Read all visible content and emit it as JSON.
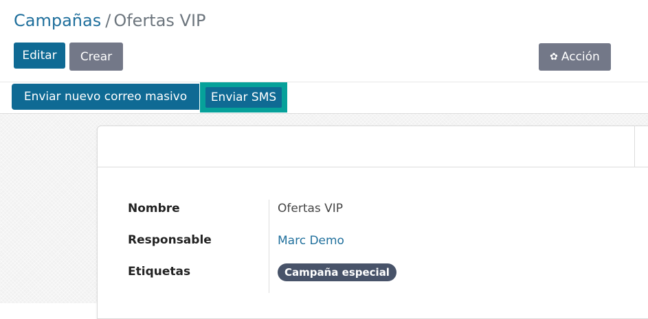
{
  "breadcrumb": {
    "parent": "Campañas",
    "separator": "/",
    "current": "Ofertas VIP"
  },
  "toolbar": {
    "edit_label": "Editar",
    "create_label": "Crear",
    "action_label": "Acción",
    "action_icon": "gear-icon"
  },
  "statusbar": {
    "mass_mail_label": "Enviar nuevo correo masivo",
    "sms_label": "Enviar SMS"
  },
  "form": {
    "fields": [
      {
        "label": "Nombre",
        "value": "Ofertas VIP"
      },
      {
        "label": "Responsable",
        "value": "Marc Demo"
      },
      {
        "label": "Etiquetas",
        "value": "Campaña especial"
      }
    ]
  },
  "colors": {
    "primary": "#0f6a94",
    "secondary": "#737888",
    "highlight": "#06a19a",
    "tag": "#485369",
    "link": "#1f6f9c"
  }
}
